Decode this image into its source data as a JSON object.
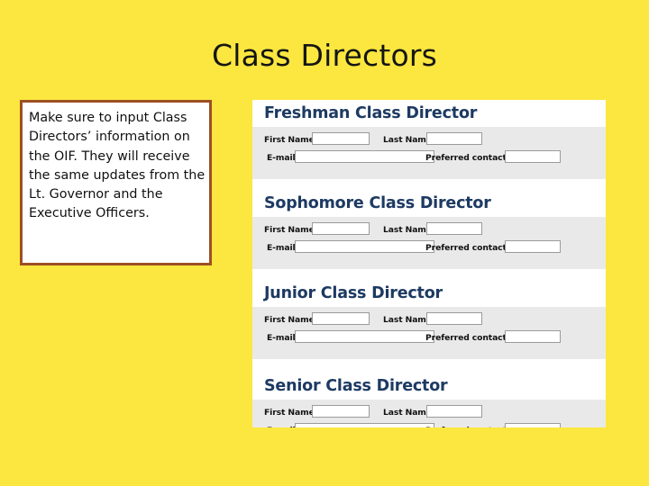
{
  "slide": {
    "title": "Class Directors",
    "background_color": "#fbe73f"
  },
  "callout": {
    "text": "Make sure to input Class Directors’ information on the OIF. They will receive the same updates from the Lt. Governor and the Executive Officers.",
    "border_color": "#9e4f24",
    "background_color": "#ffffff"
  },
  "form_panel": {
    "heading_color": "#1d3a62",
    "band_color": "#e9e9e9",
    "panel_color": "#ffffff",
    "field_labels": {
      "first_name": "First Name",
      "last_name": "Last Name",
      "email": "E-mail",
      "preferred_contact": "Preferred contact #"
    },
    "sections": [
      {
        "heading": "Freshman Class Director",
        "fields": {
          "first_name_value": "",
          "last_name_value": "",
          "email_value": "",
          "preferred_contact_value": ""
        }
      },
      {
        "heading": "Sophomore Class Director",
        "fields": {
          "first_name_value": "",
          "last_name_value": "",
          "email_value": "",
          "preferred_contact_value": ""
        }
      },
      {
        "heading": "Junior Class Director",
        "fields": {
          "first_name_value": "",
          "last_name_value": "",
          "email_value": "",
          "preferred_contact_value": ""
        }
      },
      {
        "heading": "Senior Class Director",
        "fields": {
          "first_name_value": "",
          "last_name_value": "",
          "email_value": "",
          "preferred_contact_value": ""
        }
      }
    ]
  }
}
